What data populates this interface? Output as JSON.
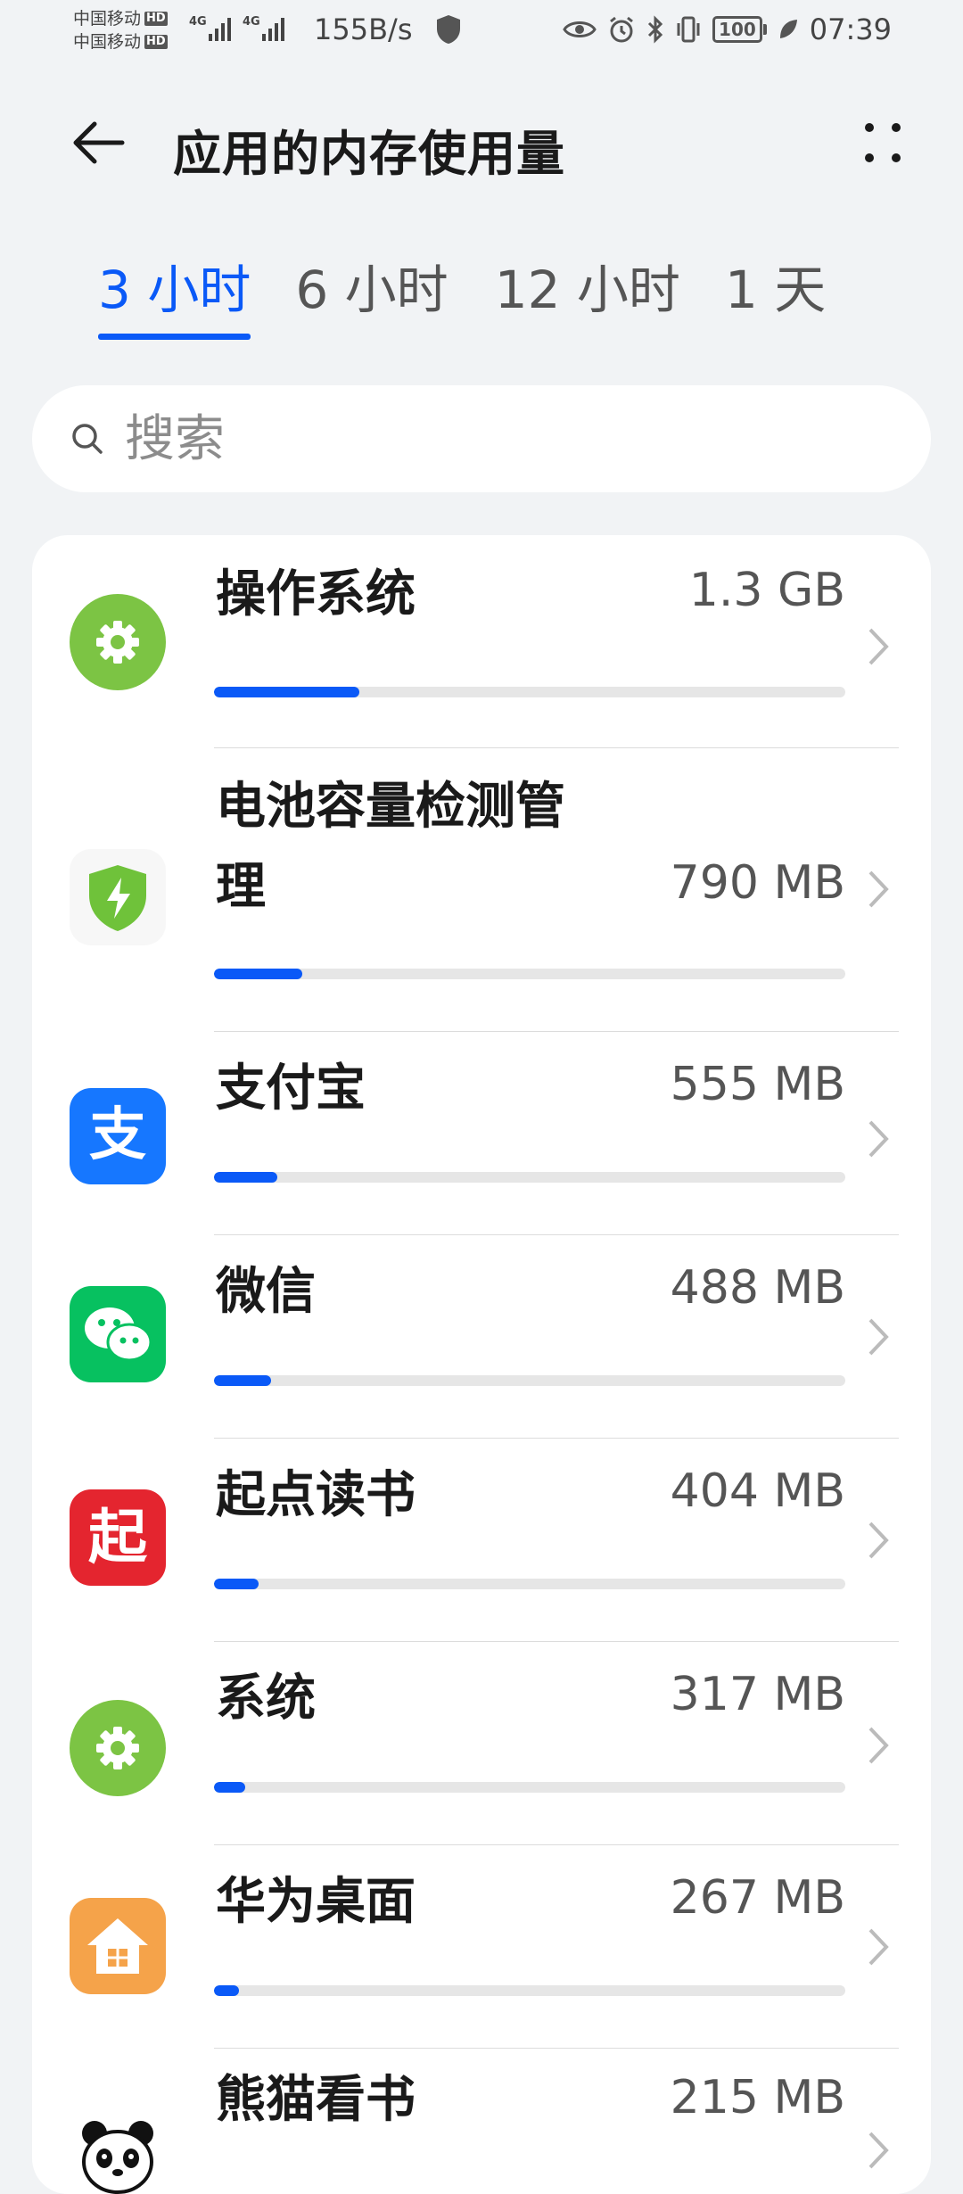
{
  "status_bar": {
    "carrier1": "中国移动",
    "carrier2": "中国移动",
    "hd": "HD",
    "network": "4G",
    "speed": "155B/s",
    "battery": "100",
    "time": "07:39"
  },
  "header": {
    "title": "应用的内存使用量"
  },
  "tabs": [
    {
      "label": "3 小时",
      "active": true
    },
    {
      "label": "6 小时",
      "active": false
    },
    {
      "label": "12 小时",
      "active": false
    },
    {
      "label": "1 天",
      "active": false
    }
  ],
  "search": {
    "placeholder": "搜索"
  },
  "apps": [
    {
      "name": "操作系统",
      "size": "1.3 GB",
      "usage": 0.23,
      "icon": "gear-icon",
      "color": "#7cc444"
    },
    {
      "name": "电池容量检测管理",
      "size": "790 MB",
      "usage": 0.14,
      "icon": "battery-shield-icon",
      "color": "#6fc23a"
    },
    {
      "name": "支付宝",
      "size": "555 MB",
      "usage": 0.1,
      "icon": "alipay-icon",
      "color": "#1677ff"
    },
    {
      "name": "微信",
      "size": "488 MB",
      "usage": 0.09,
      "icon": "wechat-icon",
      "color": "#07c160"
    },
    {
      "name": "起点读书",
      "size": "404 MB",
      "usage": 0.07,
      "icon": "qidian-icon",
      "color": "#e4252f"
    },
    {
      "name": "系统",
      "size": "317 MB",
      "usage": 0.05,
      "icon": "gear-icon",
      "color": "#7cc444"
    },
    {
      "name": "华为桌面",
      "size": "267 MB",
      "usage": 0.04,
      "icon": "home-icon",
      "color": "#f5a34a"
    },
    {
      "name": "熊猫看书",
      "size": "215 MB",
      "usage": 0.03,
      "icon": "panda-icon",
      "color": "#ffffff"
    }
  ]
}
